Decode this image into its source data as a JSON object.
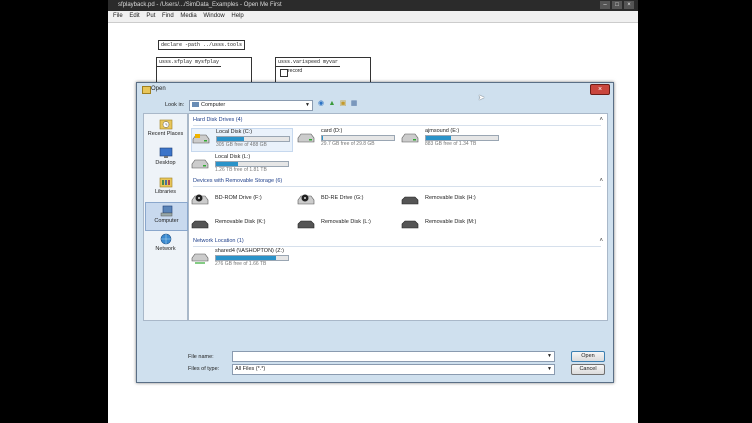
{
  "app": {
    "title": "sfplayback.pd - /Users/.../SimData_Examples - Open Me First",
    "menu": [
      "File",
      "Edit",
      "Put",
      "Find",
      "Media",
      "Window",
      "Help"
    ],
    "controls": [
      "–",
      "□",
      "×"
    ],
    "patch": {
      "declare": "declare -path ../usss.tools",
      "sfplay": "usss.sfplay mysfplay",
      "varispeed": "usss.varispeed myvar",
      "record": "record"
    }
  },
  "dialog": {
    "title": "Open",
    "close": "×",
    "look_in_label": "Look in:",
    "look_in_value": "Computer",
    "places": [
      {
        "label": "Recent Places",
        "icon": "recent-places-icon"
      },
      {
        "label": "Desktop",
        "icon": "desktop-icon"
      },
      {
        "label": "Libraries",
        "icon": "libraries-icon"
      },
      {
        "label": "Computer",
        "icon": "computer-icon",
        "selected": true
      },
      {
        "label": "Network",
        "icon": "network-icon"
      }
    ],
    "groups": {
      "hdd": "Hard Disk Drives (4)",
      "removable": "Devices with Removable Storage (6)",
      "network": "Network Location (1)"
    },
    "hard_disks": [
      {
        "name": "Local Disk (C:)",
        "free": "305 GB free of 488 GB",
        "used_pct": 37
      },
      {
        "name": "card (D:)",
        "free": "29.7 GB free of 29.8 GB",
        "used_pct": 1
      },
      {
        "name": "ajmsound (E:)",
        "free": "883 GB free of 1.34 TB",
        "used_pct": 35
      },
      {
        "name": "Local Disk (L:)",
        "free": "1.26 TB free of 1.81 TB",
        "used_pct": 30
      }
    ],
    "removable": [
      {
        "name": "BD-ROM Drive (F:)"
      },
      {
        "name": "BD-RE Drive (G:)"
      },
      {
        "name": "Removable Disk (H:)"
      },
      {
        "name": "Removable Disk (K:)"
      },
      {
        "name": "Removable Disk (L:)"
      },
      {
        "name": "Removable Disk (M:)"
      }
    ],
    "network_drives": [
      {
        "name": "shared4 (\\\\ASHOPTON) (Z:)",
        "free": "276 GB free of 1.66 TB",
        "used_pct": 84
      }
    ],
    "file_name_label": "File name:",
    "file_name_value": "",
    "file_type_label": "Files of type:",
    "file_type_value": "All Files (*.*)",
    "open_button": "Open",
    "cancel_button": "Cancel"
  }
}
